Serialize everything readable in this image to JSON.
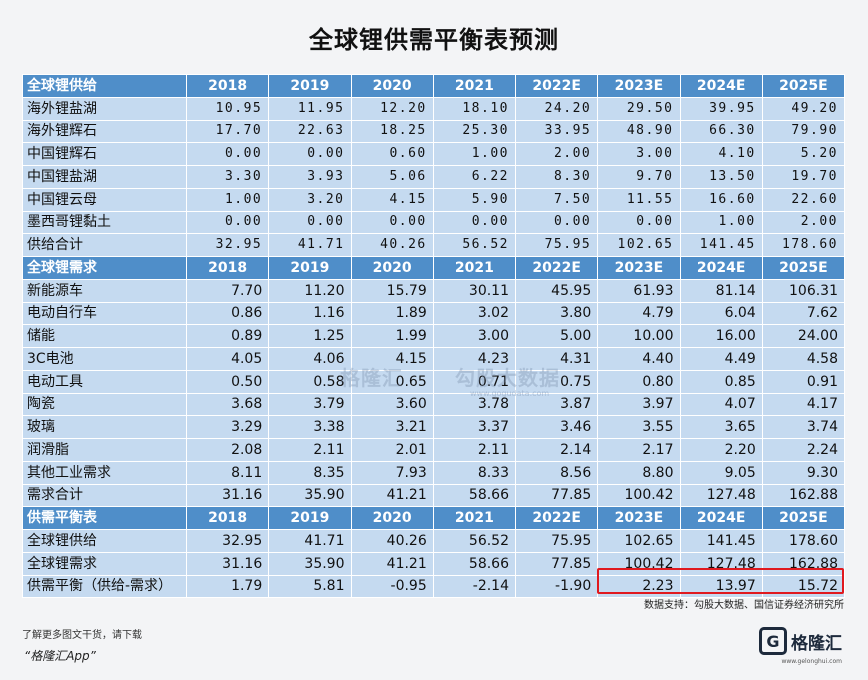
{
  "title": "全球锂供需平衡表预测",
  "years": [
    "2018",
    "2019",
    "2020",
    "2021",
    "2022E",
    "2023E",
    "2024E",
    "2025E"
  ],
  "sections": [
    {
      "header": "全球锂供给",
      "rows": [
        {
          "label": "海外锂盐湖",
          "values": [
            "10.95",
            "11.95",
            "12.20",
            "18.10",
            "24.20",
            "29.50",
            "39.95",
            "49.20"
          ]
        },
        {
          "label": "海外锂辉石",
          "values": [
            "17.70",
            "22.63",
            "18.25",
            "25.30",
            "33.95",
            "48.90",
            "66.30",
            "79.90"
          ]
        },
        {
          "label": "中国锂辉石",
          "values": [
            "0.00",
            "0.00",
            "0.60",
            "1.00",
            "2.00",
            "3.00",
            "4.10",
            "5.20"
          ]
        },
        {
          "label": "中国锂盐湖",
          "values": [
            "3.30",
            "3.93",
            "5.06",
            "6.22",
            "8.30",
            "9.70",
            "13.50",
            "19.70"
          ]
        },
        {
          "label": "中国锂云母",
          "values": [
            "1.00",
            "3.20",
            "4.15",
            "5.90",
            "7.50",
            "11.55",
            "16.60",
            "22.60"
          ]
        },
        {
          "label": "墨西哥锂黏土",
          "values": [
            "0.00",
            "0.00",
            "0.00",
            "0.00",
            "0.00",
            "0.00",
            "1.00",
            "2.00"
          ]
        },
        {
          "label": "供给合计",
          "values": [
            "32.95",
            "41.71",
            "40.26",
            "56.52",
            "75.95",
            "102.65",
            "141.45",
            "178.60"
          ]
        }
      ]
    },
    {
      "header": "全球锂需求",
      "rows": [
        {
          "label": "新能源车",
          "values": [
            "7.70",
            "11.20",
            "15.79",
            "30.11",
            "45.95",
            "61.93",
            "81.14",
            "106.31"
          ]
        },
        {
          "label": "电动自行车",
          "values": [
            "0.86",
            "1.16",
            "1.89",
            "3.02",
            "3.80",
            "4.79",
            "6.04",
            "7.62"
          ]
        },
        {
          "label": "储能",
          "values": [
            "0.89",
            "1.25",
            "1.99",
            "3.00",
            "5.00",
            "10.00",
            "16.00",
            "24.00"
          ]
        },
        {
          "label": "3C电池",
          "values": [
            "4.05",
            "4.06",
            "4.15",
            "4.23",
            "4.31",
            "4.40",
            "4.49",
            "4.58"
          ]
        },
        {
          "label": "电动工具",
          "values": [
            "0.50",
            "0.58",
            "0.65",
            "0.71",
            "0.75",
            "0.80",
            "0.85",
            "0.91"
          ]
        },
        {
          "label": "陶瓷",
          "values": [
            "3.68",
            "3.79",
            "3.60",
            "3.78",
            "3.87",
            "3.97",
            "4.07",
            "4.17"
          ]
        },
        {
          "label": "玻璃",
          "values": [
            "3.29",
            "3.38",
            "3.21",
            "3.37",
            "3.46",
            "3.55",
            "3.65",
            "3.74"
          ]
        },
        {
          "label": "润滑脂",
          "values": [
            "2.08",
            "2.11",
            "2.01",
            "2.11",
            "2.14",
            "2.17",
            "2.20",
            "2.24"
          ]
        },
        {
          "label": "其他工业需求",
          "values": [
            "8.11",
            "8.35",
            "7.93",
            "8.33",
            "8.56",
            "8.80",
            "9.05",
            "9.30"
          ]
        },
        {
          "label": "需求合计",
          "values": [
            "31.16",
            "35.90",
            "41.21",
            "58.66",
            "77.85",
            "100.42",
            "127.48",
            "162.88"
          ]
        }
      ]
    },
    {
      "header": "供需平衡表",
      "rows": [
        {
          "label": "全球锂供给",
          "values": [
            "32.95",
            "41.71",
            "40.26",
            "56.52",
            "75.95",
            "102.65",
            "141.45",
            "178.60"
          ]
        },
        {
          "label": "全球锂需求",
          "values": [
            "31.16",
            "35.90",
            "41.21",
            "58.66",
            "77.85",
            "100.42",
            "127.48",
            "162.88"
          ]
        },
        {
          "label": "供需平衡（供给-需求）",
          "values": [
            "1.79",
            "5.81",
            "-0.95",
            "-2.14",
            "-1.90",
            "2.23",
            "13.97",
            "15.72"
          ]
        }
      ]
    }
  ],
  "source": "数据支持：勾股大数据、国信证券经济研究所",
  "watermarks": {
    "left": "格隆汇",
    "right": "勾股大数据",
    "right_sub": "www.gogudata.com"
  },
  "footer": {
    "line1": "了解更多图文干货，请下载",
    "line2": "“格隆汇App”"
  },
  "logo": {
    "mark": "G",
    "text": "格隆汇",
    "url": "www.gelonghui.com"
  }
}
